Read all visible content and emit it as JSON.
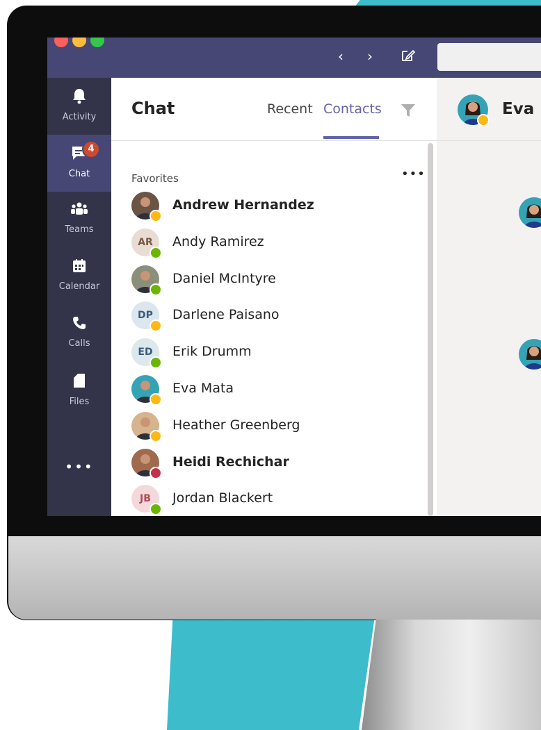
{
  "window": {
    "buttons": [
      "close",
      "minimize",
      "maximize"
    ]
  },
  "nav": {
    "back_icon": "‹",
    "forward_icon": "›",
    "compose_icon": "✎"
  },
  "rail": {
    "items": [
      {
        "label": "Activity",
        "icon": "bell-icon"
      },
      {
        "label": "Chat",
        "icon": "chat-icon",
        "badge": "4"
      },
      {
        "label": "Teams",
        "icon": "teams-icon"
      },
      {
        "label": "Calendar",
        "icon": "calendar-icon"
      },
      {
        "label": "Calls",
        "icon": "phone-icon"
      },
      {
        "label": "Files",
        "icon": "file-icon"
      }
    ],
    "more": "•••"
  },
  "chat": {
    "title": "Chat",
    "tabs": {
      "recent": "Recent",
      "contacts": "Contacts"
    },
    "favorites_label": "Favorites",
    "more": "•••",
    "contacts": [
      {
        "name": "Andrew Hernandez",
        "initials": "",
        "status": "away",
        "bold": true
      },
      {
        "name": "Andy Ramirez",
        "initials": "AR",
        "status": "available",
        "bold": false
      },
      {
        "name": "Daniel McIntyre",
        "initials": "",
        "status": "available",
        "bold": false
      },
      {
        "name": "Darlene Paisano",
        "initials": "DP",
        "status": "away",
        "bold": false
      },
      {
        "name": "Erik Drumm",
        "initials": "ED",
        "status": "available",
        "bold": false
      },
      {
        "name": "Eva Mata",
        "initials": "",
        "status": "away",
        "bold": false
      },
      {
        "name": "Heather Greenberg",
        "initials": "",
        "status": "away",
        "bold": false
      },
      {
        "name": "Heidi Rechichar",
        "initials": "",
        "status": "busy",
        "bold": true
      },
      {
        "name": "Jordan Blackert",
        "initials": "JB",
        "status": "available",
        "bold": false
      }
    ]
  },
  "conversation": {
    "title": "Eva M"
  },
  "colors": {
    "brand": "#464775",
    "accent": "#6264a7",
    "rail": "#33344a",
    "teal": "#3dbccb"
  }
}
